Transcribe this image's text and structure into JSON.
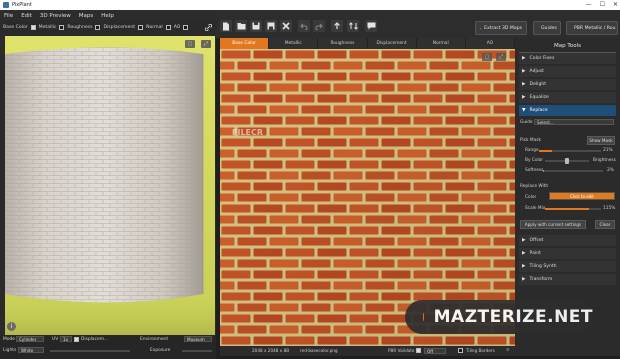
{
  "window": {
    "title": "PixPlant",
    "min": "—",
    "max": "☐",
    "close": "✕"
  },
  "menu": [
    {
      "label": "File"
    },
    {
      "label": "Edit"
    },
    {
      "label": "3D Preview"
    },
    {
      "label": "Maps"
    },
    {
      "label": "Help"
    }
  ],
  "material_bar": {
    "items": [
      {
        "label": "Base Color",
        "checked": true
      },
      {
        "label": "Metallic",
        "checked": false
      },
      {
        "label": "Roughness",
        "checked": false
      },
      {
        "label": "Displacement",
        "checked": false
      },
      {
        "label": "Normal",
        "checked": false
      },
      {
        "label": "AO",
        "checked": false
      }
    ]
  },
  "toolbar": {
    "extract_3d_maps": "Extract 3D Maps",
    "guides": "Guides",
    "pbr_mode": "PBR Metallic / Rou"
  },
  "left_bottom": {
    "mode_label": "Mode",
    "mode_value": "Cylinder",
    "uv_label": "UV",
    "uv_value": "1x",
    "displacement_label": "Displacem...",
    "environment_label": "Environment",
    "environment_value": "Museum",
    "lights_label": "Lights",
    "lights_value": "White",
    "exposure_label": "Exposure"
  },
  "center_tabs": [
    {
      "label": "Base Color",
      "active": true
    },
    {
      "label": "Metallic",
      "active": false
    },
    {
      "label": "Roughness",
      "active": false
    },
    {
      "label": "Displacement",
      "active": false
    },
    {
      "label": "Normal",
      "active": false
    },
    {
      "label": "AO",
      "active": false
    }
  ],
  "status": {
    "dimensions": "2048 x 2048 x 8B",
    "filename": "red-basecolor.png",
    "pbr_validate": "PBR Validate",
    "view_value": "Off",
    "tile_borders": "Tiling Borders"
  },
  "map_tools": {
    "title": "Map Tools",
    "sections": [
      {
        "label": "Color Fixes",
        "active": false
      },
      {
        "label": "Adjust",
        "active": false
      },
      {
        "label": "Delight",
        "active": false
      },
      {
        "label": "Equalize",
        "active": false
      },
      {
        "label": "Replace",
        "active": true
      }
    ],
    "guide_label": "Guide",
    "guide_value": "Select...",
    "pick_mask_label": "Pick Mask",
    "show_mask_button": "Show Mask",
    "range_label": "Range",
    "range_value": "21%",
    "range_fraction": 0.21,
    "by_color_label": "By Color",
    "brightness_label": "Brightness",
    "softness_label": "Softness",
    "softness_value": "2%",
    "softness_fraction": 0.02,
    "replace_with_label": "Replace With",
    "color_label": "Color",
    "color_value": "Click to edit",
    "color_swatch": "#e27a1e",
    "scale_mix_label": "Scale Mix",
    "scale_mix_value": "115%",
    "scale_mix_fraction": 0.78,
    "apply_button": "Apply with current settings",
    "clear_button": "Clear",
    "bottom_sections": [
      {
        "label": "Offset"
      },
      {
        "label": "Paint"
      },
      {
        "label": "Tiling Synth"
      },
      {
        "label": "Transform"
      }
    ]
  },
  "watermark": {
    "text": "MAZTERIZE.NET",
    "fs": "FILECR"
  },
  "colors": {
    "accent": "#e1781f",
    "panel": "#2b2b2b",
    "brick": "#c8542a",
    "mortar": "#e3cf8a"
  },
  "icons": [
    "app-icon",
    "new-icon",
    "open-icon",
    "save-icon",
    "save-as-icon",
    "close-icon",
    "undo-icon",
    "redo-icon",
    "export-icon",
    "transfer-icon",
    "comment-icon",
    "extract-icon",
    "guides-icon",
    "pbr-icon",
    "info-icon",
    "chevron-right-icon",
    "chevron-down-icon",
    "link-icon",
    "settings-icon"
  ]
}
